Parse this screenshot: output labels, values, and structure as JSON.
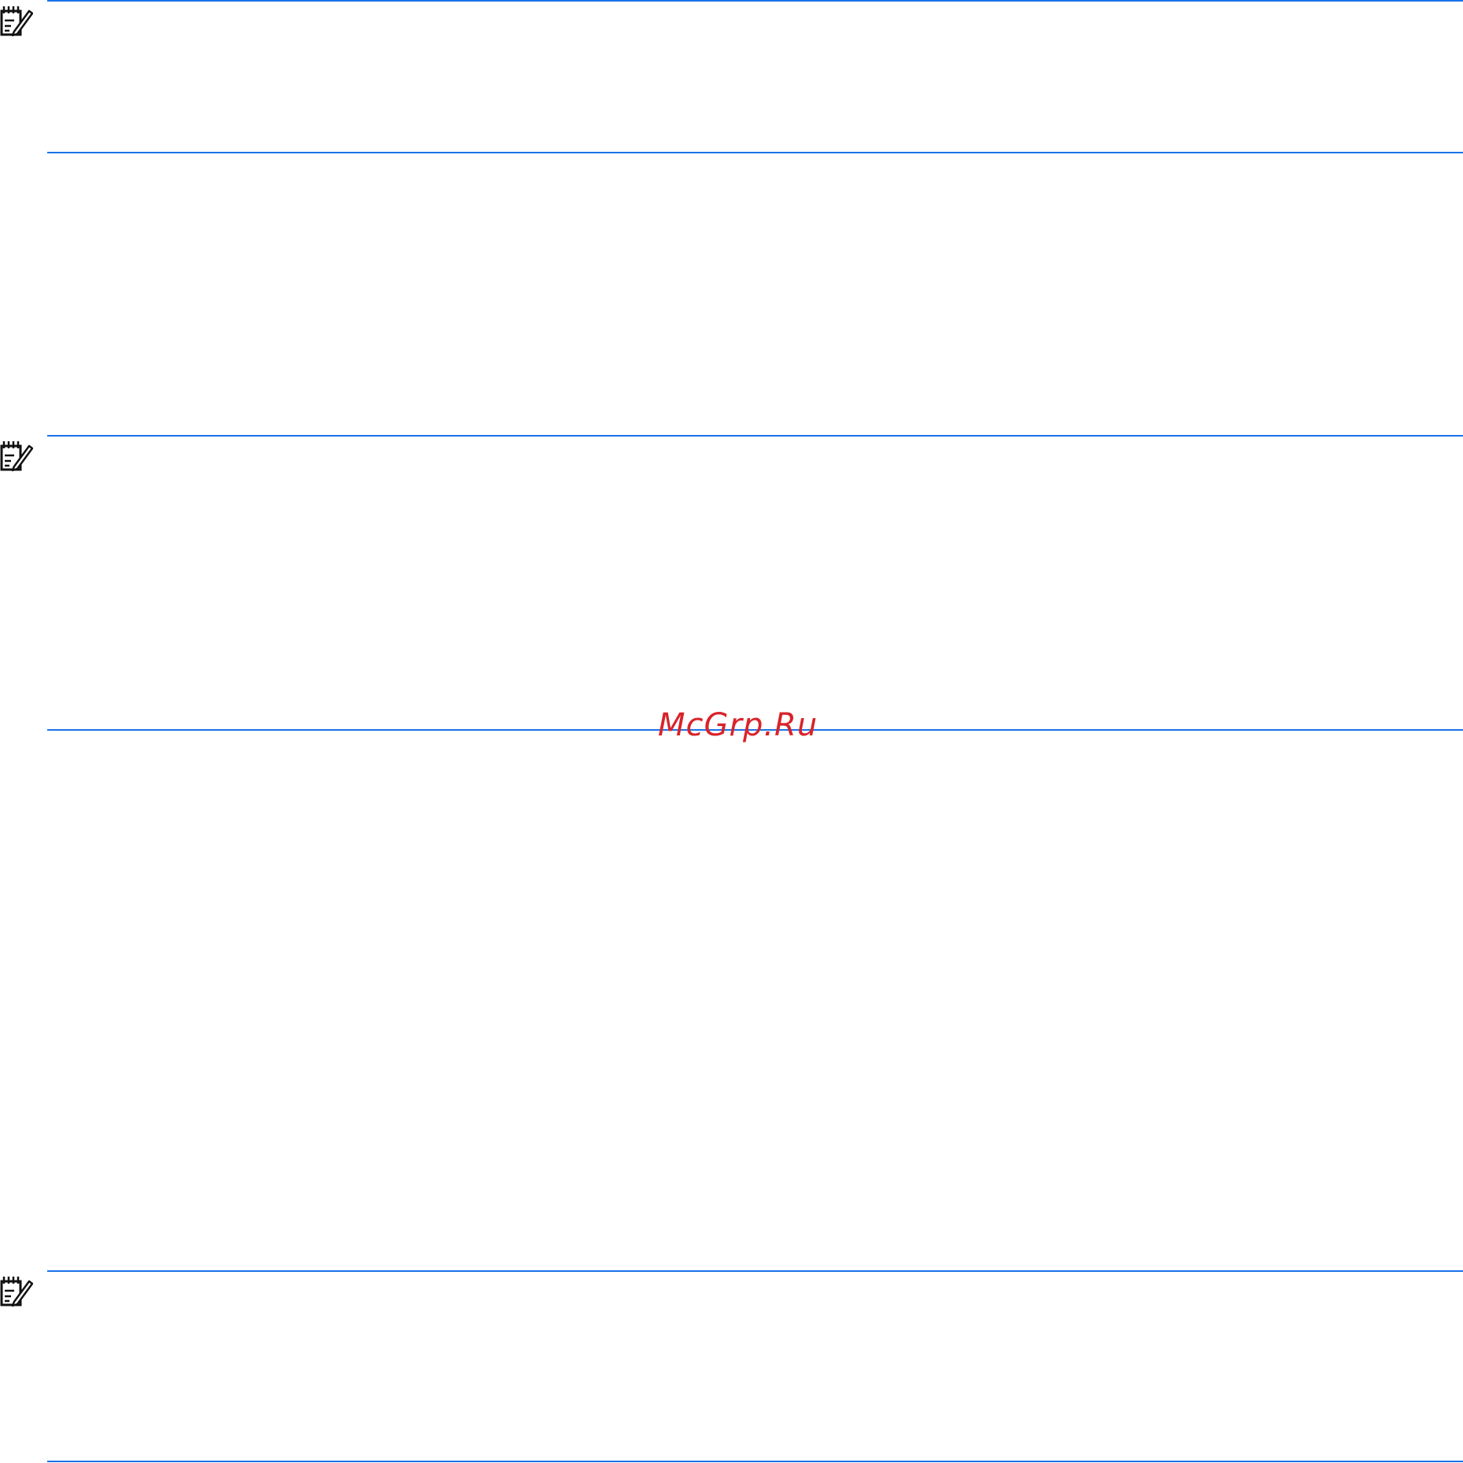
{
  "watermark": {
    "text": "McGrp.Ru",
    "color": "#d8232a"
  },
  "notes": [
    {
      "icon": "note-pencil-icon"
    },
    {
      "icon": "note-pencil-icon"
    },
    {
      "icon": "note-pencil-icon"
    }
  ],
  "colors": {
    "rule": "#1a73e8",
    "icon": "#111111",
    "background": "#ffffff"
  }
}
